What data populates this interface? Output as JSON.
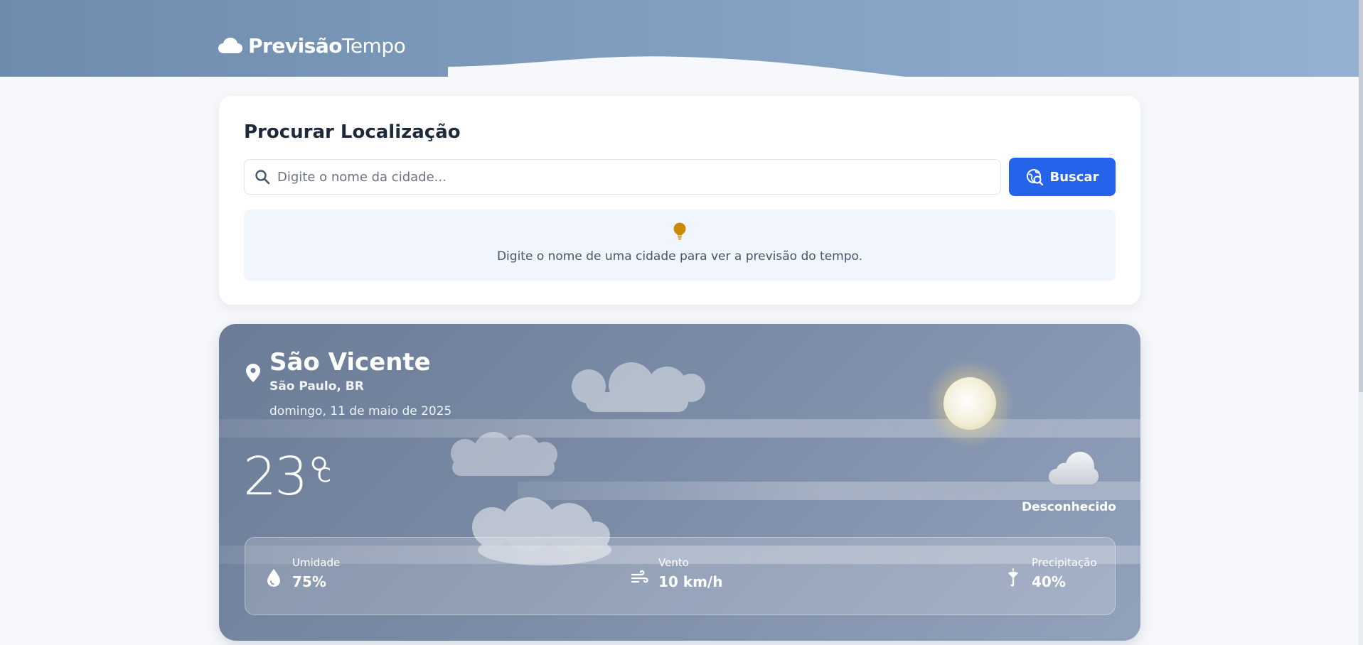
{
  "brand": {
    "part1": "Previsão",
    "part2": "Tempo"
  },
  "search": {
    "title": "Procurar Localização",
    "placeholder": "Digite o nome da cidade...",
    "value": "",
    "button_label": "Buscar",
    "hint": "Digite o nome de uma cidade para ver a previsão do tempo."
  },
  "weather": {
    "city": "São Vicente",
    "region": "São Paulo, BR",
    "date": "domingo, 11 de maio de 2025",
    "temperature": "23°",
    "unit": "C",
    "condition": "Desconhecido",
    "stats": {
      "humidity": {
        "label": "Umidade",
        "value": "75%"
      },
      "wind": {
        "label": "Vento",
        "value": "10 km/h"
      },
      "precipitation": {
        "label": "Precipitação",
        "value": "40%"
      }
    }
  },
  "icons": {
    "logo": "cloud-icon",
    "search": "search-icon",
    "button": "globe-search-icon",
    "hint": "lightbulb-icon",
    "location": "map-pin-icon",
    "condition": "cloud-icon",
    "humidity": "droplet-icon",
    "wind": "wind-icon",
    "precipitation": "umbrella-icon"
  },
  "colors": {
    "accent": "#2563eb",
    "hint_icon": "#ca8a04",
    "header_start": "#6d8bab",
    "header_end": "#94b0d2"
  }
}
